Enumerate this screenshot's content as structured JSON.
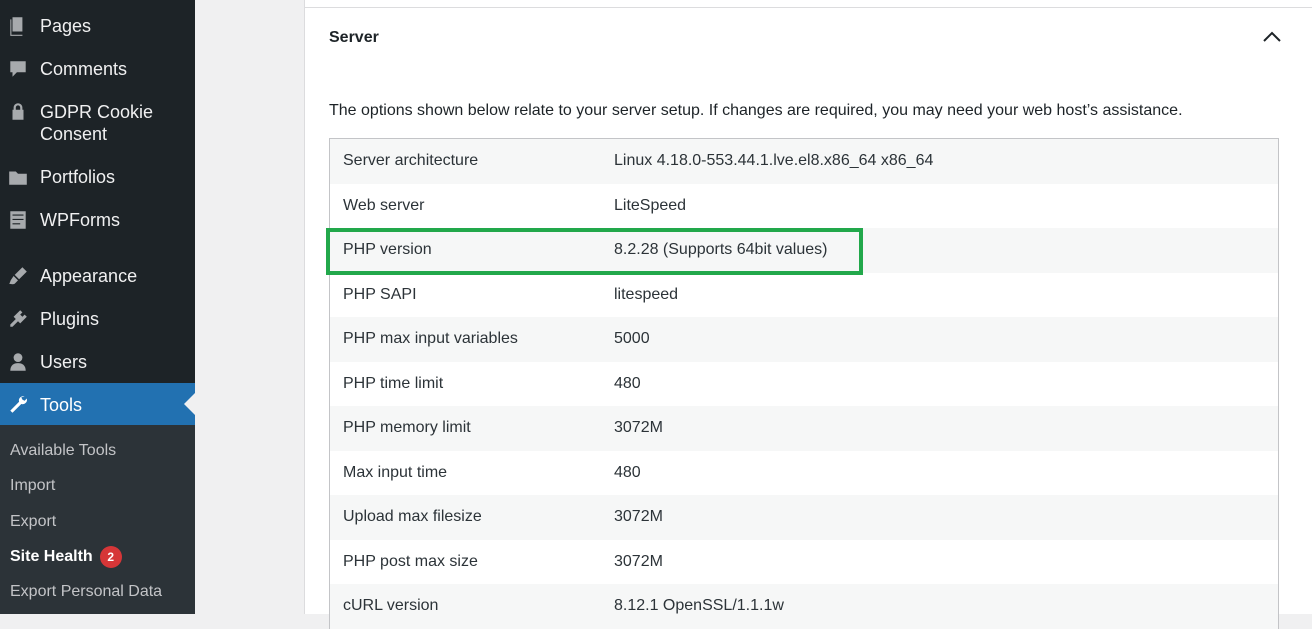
{
  "sidebar": {
    "items": [
      {
        "label": "Pages",
        "icon": "pages-icon"
      },
      {
        "label": "Comments",
        "icon": "comments-icon"
      },
      {
        "label": "GDPR Cookie\nConsent",
        "icon": "lock-icon"
      },
      {
        "label": "Portfolios",
        "icon": "folder-icon"
      },
      {
        "label": "WPForms",
        "icon": "forms-icon"
      },
      {
        "label": "Appearance",
        "icon": "brush-icon"
      },
      {
        "label": "Plugins",
        "icon": "plugin-icon"
      },
      {
        "label": "Users",
        "icon": "user-icon"
      },
      {
        "label": "Tools",
        "icon": "wrench-icon"
      }
    ],
    "submenu": [
      {
        "label": "Available Tools"
      },
      {
        "label": "Import"
      },
      {
        "label": "Export"
      },
      {
        "label": "Site Health",
        "badge": "2"
      },
      {
        "label": "Export Personal Data"
      }
    ],
    "active_color": "#2271b1",
    "badge_color": "#d63638"
  },
  "section": {
    "title": "Server",
    "intro": "The options shown below relate to your server setup. If changes are required, you may need your web host’s assistance."
  },
  "table": {
    "rows": [
      {
        "key": "Server architecture",
        "value": "Linux 4.18.0-553.44.1.lve.el8.x86_64 x86_64"
      },
      {
        "key": "Web server",
        "value": "LiteSpeed"
      },
      {
        "key": "PHP version",
        "value": "8.2.28 (Supports 64bit values)"
      },
      {
        "key": "PHP SAPI",
        "value": "litespeed"
      },
      {
        "key": "PHP max input variables",
        "value": "5000"
      },
      {
        "key": "PHP time limit",
        "value": "480"
      },
      {
        "key": "PHP memory limit",
        "value": "3072M"
      },
      {
        "key": "Max input time",
        "value": "480"
      },
      {
        "key": "Upload max filesize",
        "value": "3072M"
      },
      {
        "key": "PHP post max size",
        "value": "3072M"
      },
      {
        "key": "cURL version",
        "value": "8.12.1 OpenSSL/1.1.1w"
      }
    ]
  },
  "highlight_color": "#22a84b"
}
